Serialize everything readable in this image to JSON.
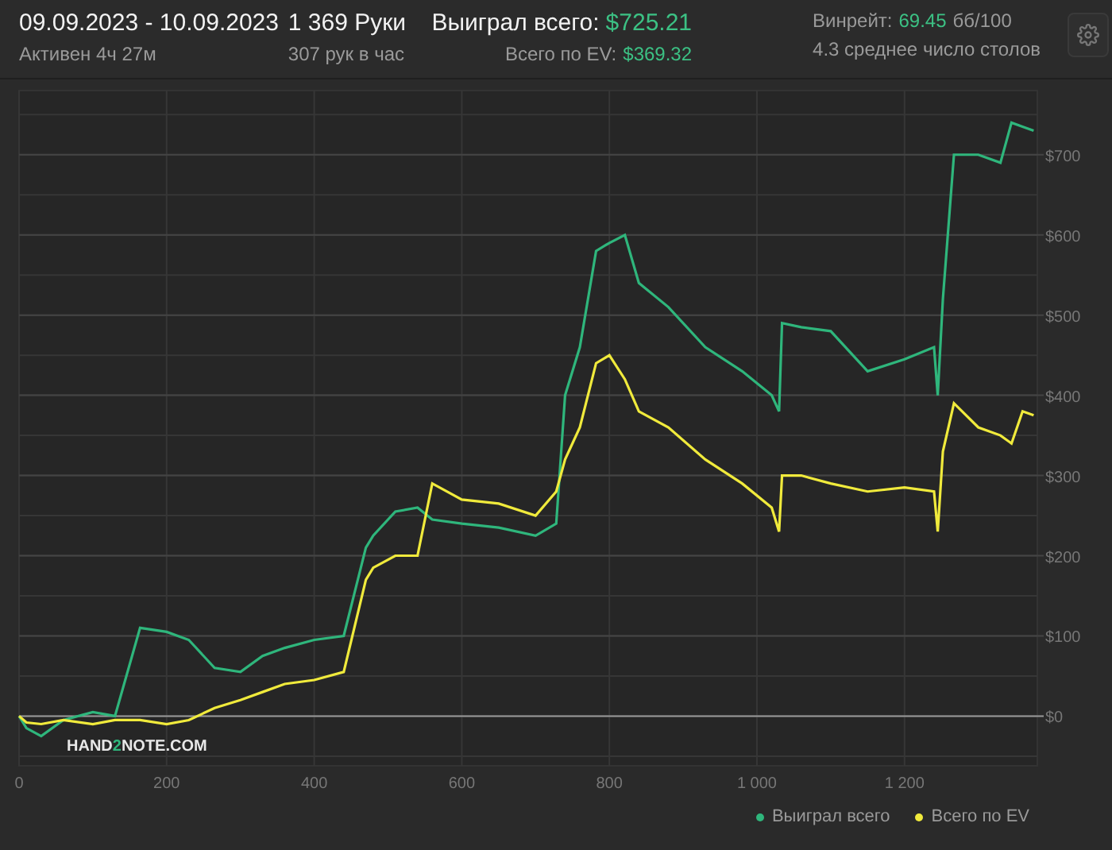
{
  "header": {
    "date_range": "09.09.2023 - 10.09.2023",
    "active": "Активен 4ч 27м",
    "hands": "1 369 Руки",
    "hands_per_hour": "307 рук в час",
    "won_label": "Выиграл всего:",
    "won_value": "$725.21",
    "ev_label": "Всего по EV:",
    "ev_value": "$369.32",
    "winrate_label": "Винрейт:",
    "winrate_value": "69.45",
    "winrate_unit": "бб/100",
    "tables": "4.3 среднее число столов"
  },
  "chart": {
    "watermark": [
      {
        "text": "HAND",
        "accent": false
      },
      {
        "text": "2",
        "accent": true
      },
      {
        "text": "NOTE.COM",
        "accent": false
      }
    ],
    "chart_data": {
      "type": "line",
      "grid": true,
      "xlim": [
        0,
        1380
      ],
      "ylim": [
        -62,
        780
      ],
      "xticks": [
        0,
        200,
        400,
        600,
        800,
        {
          "value": 1000,
          "label": "1 000"
        },
        {
          "value": 1200,
          "label": "1 200"
        }
      ],
      "yticks": [
        {
          "value": 0,
          "label": "$0"
        },
        {
          "value": 100,
          "label": "$100"
        },
        {
          "value": 200,
          "label": "$200"
        },
        {
          "value": 300,
          "label": "$300"
        },
        {
          "value": 400,
          "label": "$400"
        },
        {
          "value": 500,
          "label": "$500"
        },
        {
          "value": 600,
          "label": "$600"
        },
        {
          "value": 700,
          "label": "$700"
        }
      ],
      "x": [
        0,
        10,
        30,
        60,
        100,
        130,
        164,
        200,
        230,
        265,
        300,
        330,
        360,
        400,
        440,
        470,
        480,
        510,
        540,
        560,
        600,
        650,
        700,
        728,
        740,
        760,
        782,
        800,
        821,
        840,
        880,
        930,
        980,
        1020,
        1030,
        1034,
        1060,
        1100,
        1150,
        1200,
        1240,
        1245,
        1252,
        1267,
        1300,
        1330,
        1345,
        1360,
        1375
      ],
      "series": [
        {
          "name": "Выиграл всего",
          "color": "#2fb67c",
          "values": [
            0,
            -15,
            -25,
            -5,
            5,
            0,
            110,
            105,
            95,
            60,
            55,
            75,
            85,
            95,
            100,
            210,
            225,
            255,
            260,
            245,
            240,
            235,
            225,
            240,
            400,
            460,
            580,
            590,
            600,
            540,
            510,
            460,
            430,
            400,
            380,
            490,
            485,
            480,
            430,
            445,
            460,
            400,
            520,
            700,
            700,
            690,
            740,
            735,
            730
          ]
        },
        {
          "name": "Всего по EV",
          "color": "#f0ea3c",
          "values": [
            0,
            -8,
            -10,
            -5,
            -10,
            -5,
            -5,
            -10,
            -5,
            10,
            20,
            30,
            40,
            45,
            55,
            170,
            185,
            200,
            200,
            290,
            270,
            265,
            250,
            280,
            320,
            360,
            440,
            450,
            420,
            380,
            360,
            320,
            290,
            260,
            230,
            300,
            300,
            290,
            280,
            285,
            280,
            230,
            330,
            390,
            360,
            350,
            340,
            380,
            375
          ]
        }
      ]
    }
  }
}
